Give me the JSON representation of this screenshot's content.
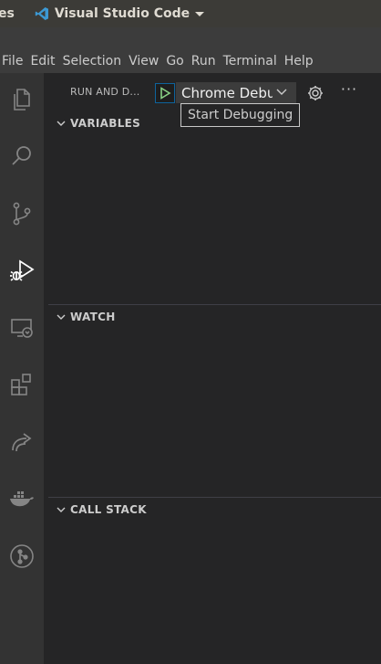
{
  "topbar": {
    "partial_label": "es",
    "app_title": "Visual Studio Code"
  },
  "menu": [
    "File",
    "Edit",
    "Selection",
    "View",
    "Go",
    "Run",
    "Terminal",
    "Help"
  ],
  "activity": [
    {
      "name": "explorer-icon"
    },
    {
      "name": "search-icon"
    },
    {
      "name": "source-control-icon"
    },
    {
      "name": "run-debug-icon"
    },
    {
      "name": "remote-explorer-icon"
    },
    {
      "name": "extensions-icon"
    },
    {
      "name": "live-share-icon"
    },
    {
      "name": "docker-icon"
    },
    {
      "name": "git-graph-icon"
    }
  ],
  "sidebar": {
    "title": "RUN AND D...",
    "config": "Chrome Debu",
    "tooltip": "Start Debugging",
    "sections": {
      "variables": "VARIABLES",
      "watch": "WATCH",
      "call_stack": "CALL STACK"
    }
  },
  "colors": {
    "accent": "#0e639c",
    "play": "#89d185"
  }
}
